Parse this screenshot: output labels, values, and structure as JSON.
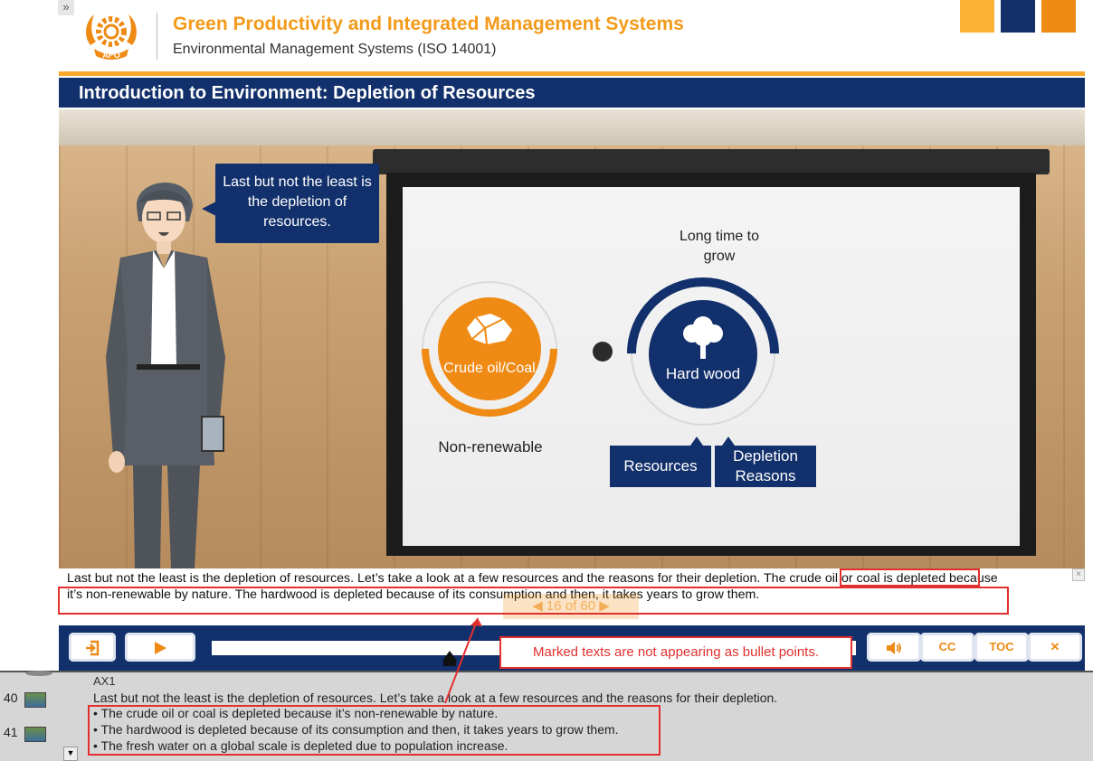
{
  "header": {
    "course_title": "Green Productivity and Integrated Management Systems",
    "course_subtitle": "Environmental Management Systems (ISO 14001)",
    "logo_text": "APO",
    "collapse_glyph": "»"
  },
  "slide": {
    "title": "Introduction to Environment: Depletion of Resources",
    "speech_bubble": "Last but not the least is the depletion of resources.",
    "diagram": {
      "long_time_label": "Long time to grow",
      "crude_label": "Crude oil/Coal",
      "crude_caption": "Non-renewable",
      "wood_label": "Hard wood",
      "tag_resources": "Resources",
      "tag_depletion": "Depletion Reasons"
    }
  },
  "caption": {
    "text": "Last but not the least is the depletion of resources. Let’s take a look at a few resources and the reasons for their depletion. The crude oil or coal is depleted because it’s non-renewable by nature. The hardwood is depleted because of its consumption and then, it takes years to grow them.",
    "close_glyph": "×",
    "slide_counter": "◀  16 of 60  ▶"
  },
  "controls": {
    "exit_icon": "exit-icon",
    "play_icon": "play-icon",
    "volume_icon": "volume-icon",
    "cc_label": "CC",
    "toc_label": "TOC",
    "close_label": "✕"
  },
  "annotation": {
    "text": "Marked texts are not appearing as bullet points."
  },
  "notes": {
    "row_40": "40",
    "row_41": "41",
    "ax_label": "AX1",
    "line1": "Last but not the least is the depletion of resources. Let’s take a look at a few resources and the reasons for their depletion.",
    "bullets": [
      "•   The crude oil or coal is depleted because it’s non-renewable by nature.",
      "•   The hardwood is depleted because of its consumption and then, it takes years to grow them.",
      "•   The fresh water on a global scale is depleted due to population increase."
    ],
    "scroll_glyph": "▼"
  },
  "colors": {
    "navy": "#12306b",
    "orange": "#ef8a14",
    "amber": "#f9b233",
    "annotation_red": "#e2302f"
  }
}
